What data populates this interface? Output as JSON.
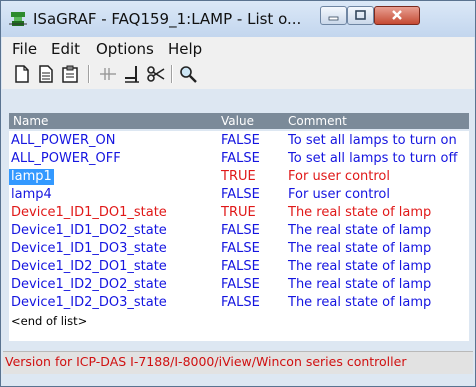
{
  "window": {
    "title": "ISaGRAF - FAQ159_1:LAMP - List o..."
  },
  "menu": {
    "items": [
      "File",
      "Edit",
      "Options",
      "Help"
    ]
  },
  "toolbar": {
    "icons": [
      "new-icon",
      "copy-icon",
      "paste-icon",
      "ladder-icon",
      "insert-icon",
      "cut-icon",
      "search-icon"
    ]
  },
  "list": {
    "headers": {
      "name": "Name",
      "value": "Value",
      "comment": "Comment"
    },
    "rows": [
      {
        "name": "ALL_POWER_ON",
        "value": "FALSE",
        "comment": "To set all lamps to turn on",
        "color": "#1515e0"
      },
      {
        "name": "ALL_POWER_OFF",
        "value": "FALSE",
        "comment": "To set all lamps to turn off",
        "color": "#1515e0"
      },
      {
        "name": "lamp1",
        "value": "TRUE",
        "comment": "For user control",
        "color": "#e01818",
        "selected": true
      },
      {
        "name": "lamp4",
        "value": "FALSE",
        "comment": "For user control",
        "color": "#1515e0"
      },
      {
        "name": "Device1_ID1_DO1_state",
        "value": "TRUE",
        "comment": "The real state of lamp",
        "color": "#e01818"
      },
      {
        "name": "Device1_ID1_DO2_state",
        "value": "FALSE",
        "comment": "The real state of lamp",
        "color": "#1515e0"
      },
      {
        "name": "Device1_ID1_DO3_state",
        "value": "FALSE",
        "comment": "The real state of lamp",
        "color": "#1515e0"
      },
      {
        "name": "Device1_ID2_DO1_state",
        "value": "FALSE",
        "comment": "The real state of lamp",
        "color": "#1515e0"
      },
      {
        "name": "Device1_ID2_DO2_state",
        "value": "FALSE",
        "comment": "The real state of lamp",
        "color": "#1515e0"
      },
      {
        "name": "Device1_ID2_DO3_state",
        "value": "FALSE",
        "comment": "The real state of lamp",
        "color": "#1515e0"
      }
    ],
    "end_marker": "<end of list>"
  },
  "status": {
    "text": "Version for ICP-DAS I-7188/I-8000/iView/Wincon series controller"
  }
}
